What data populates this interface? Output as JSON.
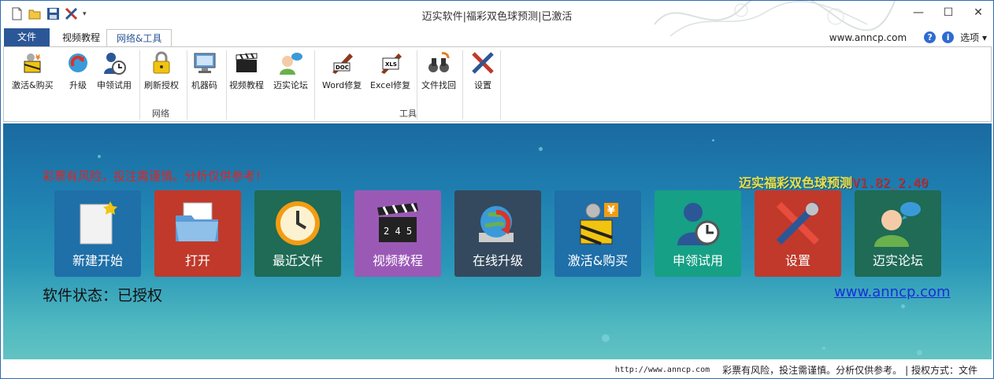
{
  "window": {
    "title": "迈实软件|福彩双色球预测|已激活",
    "controls": [
      "—",
      "☐",
      "✕"
    ]
  },
  "quick_access": {
    "icons": [
      "new-file-icon",
      "open-folder-icon",
      "save-icon",
      "tools-icon",
      "dropdown-icon"
    ]
  },
  "tabs": [
    {
      "label": "文件",
      "active": false
    },
    {
      "label": "视频教程",
      "active": false
    },
    {
      "label": "网络&工具",
      "active": true
    }
  ],
  "header_right": {
    "site": "www.anncp.com",
    "options_label": "选项"
  },
  "ribbon": {
    "buttons": [
      {
        "label": "激活&购买",
        "icon": "activate-buy-icon"
      },
      {
        "label": "升级",
        "icon": "upgrade-icon"
      },
      {
        "label": "申领试用",
        "icon": "trial-icon"
      },
      {
        "label": "刷新授权",
        "icon": "lock-icon"
      },
      {
        "label": "机器码",
        "icon": "monitor-icon"
      },
      {
        "label": "视频教程",
        "icon": "clapper-icon"
      },
      {
        "label": "迈实论坛",
        "icon": "forum-icon"
      },
      {
        "label": "Word修复",
        "icon": "doc-icon"
      },
      {
        "label": "Excel修复",
        "icon": "xls-icon"
      },
      {
        "label": "文件找回",
        "icon": "binoculars-icon"
      },
      {
        "label": "设置",
        "icon": "settings-icon"
      }
    ],
    "groups": [
      "网络",
      "工具"
    ]
  },
  "main": {
    "warning": "彩票有风险，投注需谨慎。分析仅供参考！",
    "brand_name": "迈实福彩双色球预测",
    "brand_version": "V1.82_2.40",
    "status_text": "软件状态：已授权",
    "link_text": "www.anncp.com",
    "tiles": [
      {
        "label": "新建开始",
        "color": "#1f6fa8"
      },
      {
        "label": "打开",
        "color": "#c0392b"
      },
      {
        "label": "最近文件",
        "color": "#1f6b55"
      },
      {
        "label": "视频教程",
        "color": "#9b59b6"
      },
      {
        "label": "在线升级",
        "color": "#34495e"
      },
      {
        "label": "激活&购买",
        "color": "#1f6fa8"
      },
      {
        "label": "申领试用",
        "color": "#16a085"
      },
      {
        "label": "设置",
        "color": "#c0392b"
      },
      {
        "label": "迈实论坛",
        "color": "#1f6b55"
      }
    ]
  },
  "statusbar": {
    "url": "http://www.anncp.com",
    "note": "彩票有风险，投注需谨慎。分析仅供参考。",
    "auth": "| 授权方式：文件"
  }
}
